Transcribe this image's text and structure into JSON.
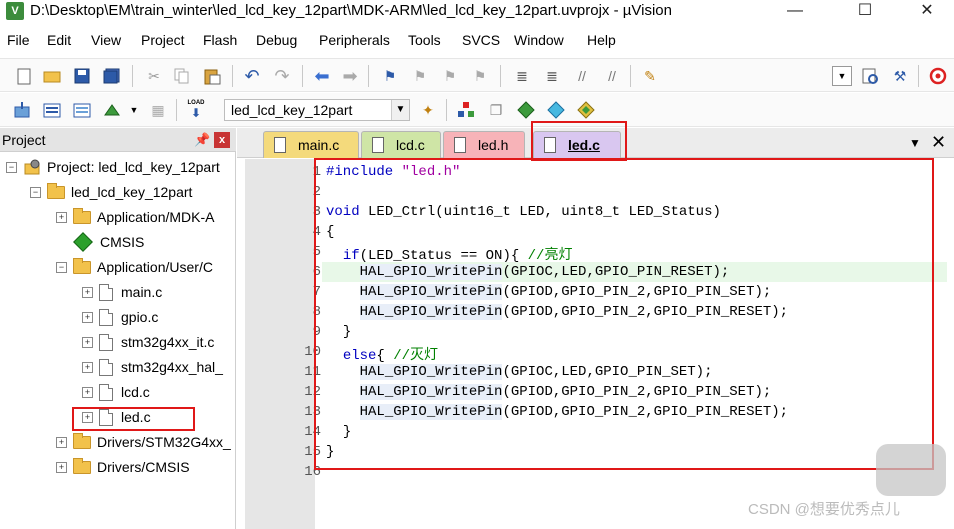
{
  "window": {
    "title": "D:\\Desktop\\EM\\train_winter\\led_lcd_key_12part\\MDK-ARM\\led_lcd_key_12part.uvprojx - µVision",
    "app_icon": "V",
    "minimize": "—",
    "maximize": "☐",
    "close": "✕"
  },
  "menu": [
    "File",
    "Edit",
    "View",
    "Project",
    "Flash",
    "Debug",
    "Peripherals",
    "Tools",
    "SVCS",
    "Window",
    "Help"
  ],
  "toolbar2": {
    "target": "led_lcd_key_12part",
    "load_label": "LOAD"
  },
  "project_panel": {
    "title": "Project",
    "pin": "ᴘ",
    "close": "x",
    "tree": {
      "root": "Project: led_lcd_key_12part",
      "target": "led_lcd_key_12part",
      "groups": [
        {
          "label": "Application/MDK-A"
        },
        {
          "label": "CMSIS"
        },
        {
          "label": "Application/User/C"
        }
      ],
      "files": [
        "main.c",
        "gpio.c",
        "stm32g4xx_it.c",
        "stm32g4xx_hal_",
        "lcd.c",
        "led.c"
      ],
      "tail_groups": [
        "Drivers/STM32G4xx_",
        "Drivers/CMSIS"
      ]
    }
  },
  "editor": {
    "tabs": [
      "main.c",
      "lcd.c",
      "led.h",
      "led.c"
    ],
    "active_tab": "led.c",
    "tab_menu": "▼",
    "tab_close": "✕",
    "line_numbers": [
      "1",
      "2",
      "3",
      "4",
      "5",
      "6",
      "7",
      "8",
      "9",
      "10",
      "11",
      "12",
      "13",
      "14",
      "15",
      "16"
    ],
    "code": {
      "l1_pp": "#include",
      "l1_str": "\"led.h\"",
      "l3_kw": "void",
      "l3_rest": " LED_Ctrl(uint16_t LED, uint8_t LED_Status)",
      "l4": "{",
      "l5_kw": "if",
      "l5_rest": "(LED_Status == ON){ ",
      "l5_cm": "//亮灯",
      "l6_fn": "HAL_GPIO_WritePin",
      "l6_rest": "(GPIOC,LED,GPIO_PIN_RESET);",
      "l7_fn": "HAL_GPIO_WritePin",
      "l7_rest": "(GPIOD,GPIO_PIN_2,GPIO_PIN_SET);",
      "l8_fn": "HAL_GPIO_WritePin",
      "l8_rest": "(GPIOD,GPIO_PIN_2,GPIO_PIN_RESET);",
      "l9": "}",
      "l10_kw": "else",
      "l10_rest": "{ ",
      "l10_cm": "//灭灯",
      "l11_fn": "HAL_GPIO_WritePin",
      "l11_rest": "(GPIOC,LED,GPIO_PIN_SET);",
      "l12_fn": "HAL_GPIO_WritePin",
      "l12_rest": "(GPIOD,GPIO_PIN_2,GPIO_PIN_SET);",
      "l13_fn": "HAL_GPIO_WritePin",
      "l13_rest": "(GPIOD,GPIO_PIN_2,GPIO_PIN_RESET);",
      "l14": "}",
      "l15": "}"
    }
  },
  "watermark": "CSDN @想要优秀点儿",
  "colors": {
    "annotation": "#e01818",
    "keyword": "#0000c0",
    "string": "#a000a0",
    "comment": "#008000"
  }
}
